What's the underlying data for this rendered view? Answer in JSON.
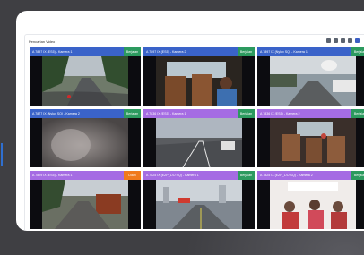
{
  "panel": {
    "title": "Pencarian Video"
  },
  "colors": {
    "blue_bar": "#3a63c9",
    "purple_bar": "#a56ce3",
    "status_green": "#2c9a5f",
    "status_orange": "#f07a1c"
  },
  "tiles": [
    {
      "label": "A 7897 IX (ES5) - Kamera 1",
      "status": "Berjalan",
      "bar": "blue",
      "status_color": "green",
      "scene": "road-trees"
    },
    {
      "label": "A 7897 IX (ES5) - Kamera 2",
      "status": "Berjalan",
      "bar": "blue",
      "status_color": "green",
      "scene": "cabin-driver"
    },
    {
      "label": "A 7897 IX (Nylux SQ) - Kamera 1",
      "status": "Berjalan",
      "bar": "blue",
      "status_color": "green",
      "scene": "road-town"
    },
    {
      "label": "A 7877 IX (Nylux SQ) - Kamera 2",
      "status": "Berjalan",
      "bar": "blue",
      "status_color": "green",
      "scene": "blurred"
    },
    {
      "label": "A 7836 IX (ES5) - Kamera 1",
      "status": "Berjalan",
      "bar": "purple",
      "status_color": "green",
      "scene": "highway"
    },
    {
      "label": "A 7836 IX (ES5) - Kamera 2",
      "status": "Berjalan",
      "bar": "purple",
      "status_color": "green",
      "scene": "cabin-seats"
    },
    {
      "label": "A 7829 IX (ES5) - Kamera 1",
      "status": "Diam",
      "bar": "purple",
      "status_color": "orange",
      "scene": "road-truck"
    },
    {
      "label": "A 7825 IX (EZP_L/O SQ) - Kamera 1",
      "status": "Berjalan",
      "bar": "purple",
      "status_color": "green",
      "scene": "road-city"
    },
    {
      "label": "A 7825 IX (EZP_L/O SQ) - Kamera 2",
      "status": "Berjalan",
      "bar": "purple",
      "status_color": "green",
      "scene": "cabin-passengers"
    }
  ]
}
